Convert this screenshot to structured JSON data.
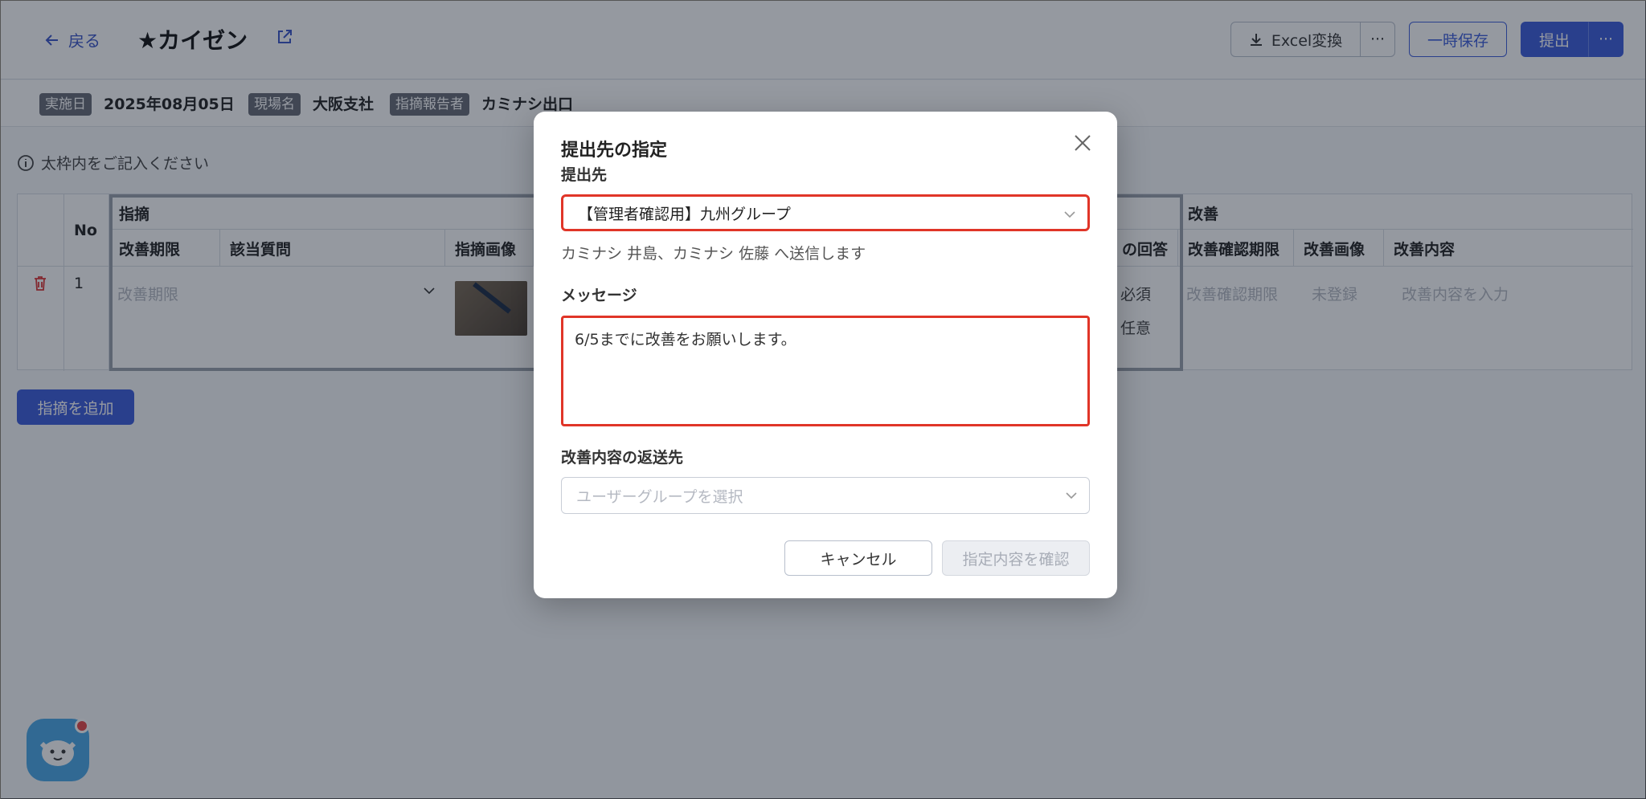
{
  "header": {
    "back_label": "戻る",
    "title": "★カイゼン",
    "excel_label": "Excel変換",
    "more_label": "···",
    "save_label": "一時保存",
    "submit_label": "提出",
    "submit_more_label": "···"
  },
  "meta": {
    "date_tag": "実施日",
    "date_value": "2025年08月05日",
    "site_tag": "現場名",
    "site_value": "大阪支社",
    "reporter_tag": "指摘報告者",
    "reporter_value": "カミナシ出口"
  },
  "note": "太枠内をご記入ください",
  "table": {
    "no_header": "No",
    "group1": "指摘",
    "group2": "改善",
    "cols": [
      "改善期限",
      "該当質問",
      "指摘画像",
      "の回答",
      "改善確認期限",
      "改善画像",
      "改善内容"
    ],
    "row": {
      "no": "1",
      "deadline_placeholder": "改善期限",
      "required": "必須",
      "optional": "任意",
      "confirm_placeholder": "改善確認期限",
      "image_placeholder": "未登録",
      "content_placeholder": "改善内容を入力"
    }
  },
  "add_button": "指摘を追加",
  "modal": {
    "title": "提出先の指定",
    "dest_label": "提出先",
    "dest_value": "【管理者確認用】九州グループ",
    "dest_sub": "カミナシ 井島、カミナシ 佐藤 へ送信します",
    "message_label": "メッセージ",
    "message_value": "6/5までに改善をお願いします。",
    "return_label": "改善内容の返送先",
    "return_placeholder": "ユーザーグループを選択",
    "cancel_label": "キャンセル",
    "confirm_label": "指定内容を確認"
  },
  "colors": {
    "primary": "#3b5bdb",
    "highlight": "#e03528"
  }
}
